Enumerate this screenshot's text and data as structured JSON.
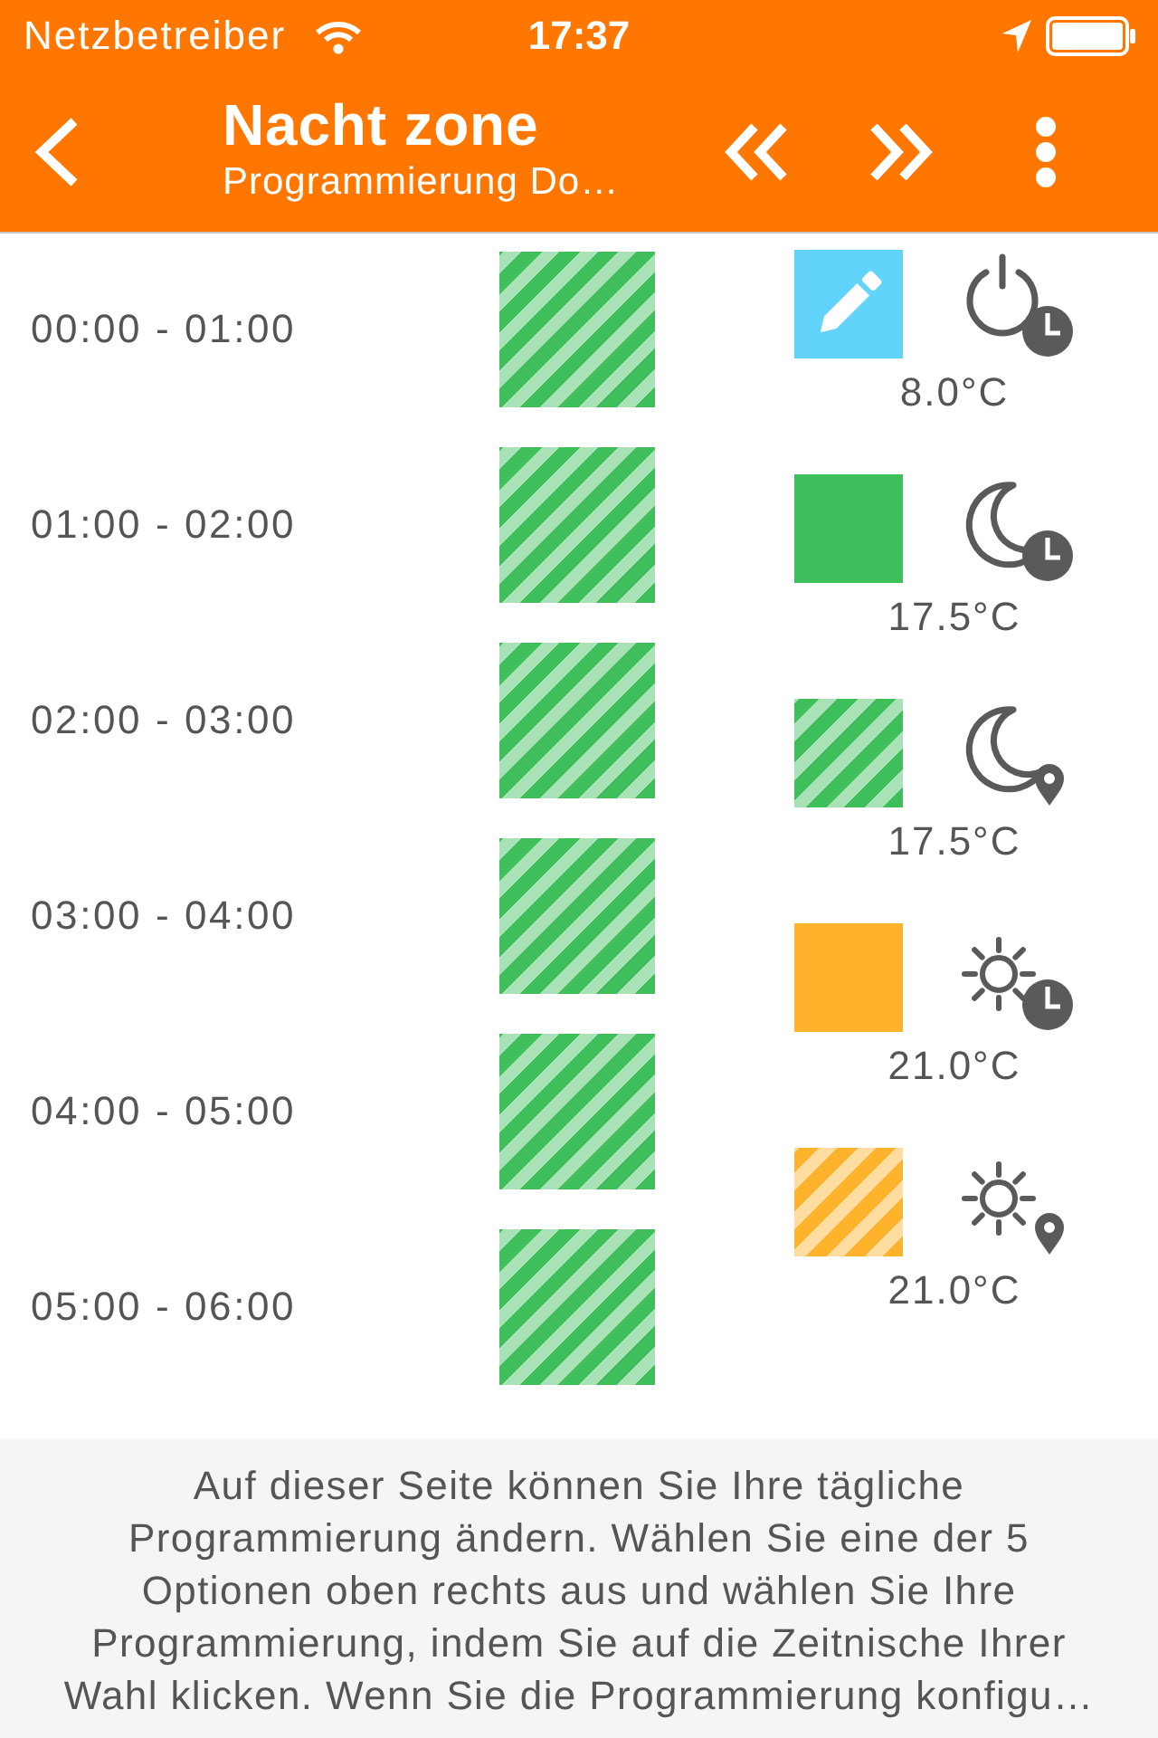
{
  "status_bar": {
    "carrier": "Netzbetreiber",
    "time": "17:37"
  },
  "nav_bar": {
    "title": "Nacht zone",
    "subtitle": "Programmierung Do…"
  },
  "slots": [
    {
      "time": "00:00 - 01:00",
      "color": "#3fbf5c",
      "striped": true
    },
    {
      "time": "01:00 - 02:00",
      "color": "#3fbf5c",
      "striped": true
    },
    {
      "time": "02:00 - 03:00",
      "color": "#3fbf5c",
      "striped": true
    },
    {
      "time": "03:00 - 04:00",
      "color": "#3fbf5c",
      "striped": true
    },
    {
      "time": "04:00 - 05:00",
      "color": "#3fbf5c",
      "striped": true
    },
    {
      "time": "05:00 - 06:00",
      "color": "#3fbf5c",
      "striped": true
    }
  ],
  "options": [
    {
      "kind": "power_clock",
      "color": "#62d4fc",
      "striped": false,
      "editable": true,
      "temperature": "8.0°C"
    },
    {
      "kind": "moon_clock",
      "color": "#3fbf5c",
      "striped": false,
      "editable": false,
      "temperature": "17.5°C"
    },
    {
      "kind": "moon_pin",
      "color": "#3fbf5c",
      "striped": true,
      "editable": false,
      "temperature": "17.5°C"
    },
    {
      "kind": "sun_clock",
      "color": "#ffb22c",
      "striped": false,
      "editable": false,
      "temperature": "21.0°C"
    },
    {
      "kind": "sun_pin",
      "color": "#ffb22c",
      "striped": true,
      "editable": false,
      "temperature": "21.0°C"
    }
  ],
  "help_text": "Auf dieser Seite können Sie Ihre tägliche\nProgrammierung ändern. Wählen Sie eine der 5\nOptionen oben rechts aus und wählen Sie Ihre\nProgrammierung, indem Sie auf die Zeitnische Ihrer\nWahl klicken. Wenn Sie die Programmierung konfigu…"
}
